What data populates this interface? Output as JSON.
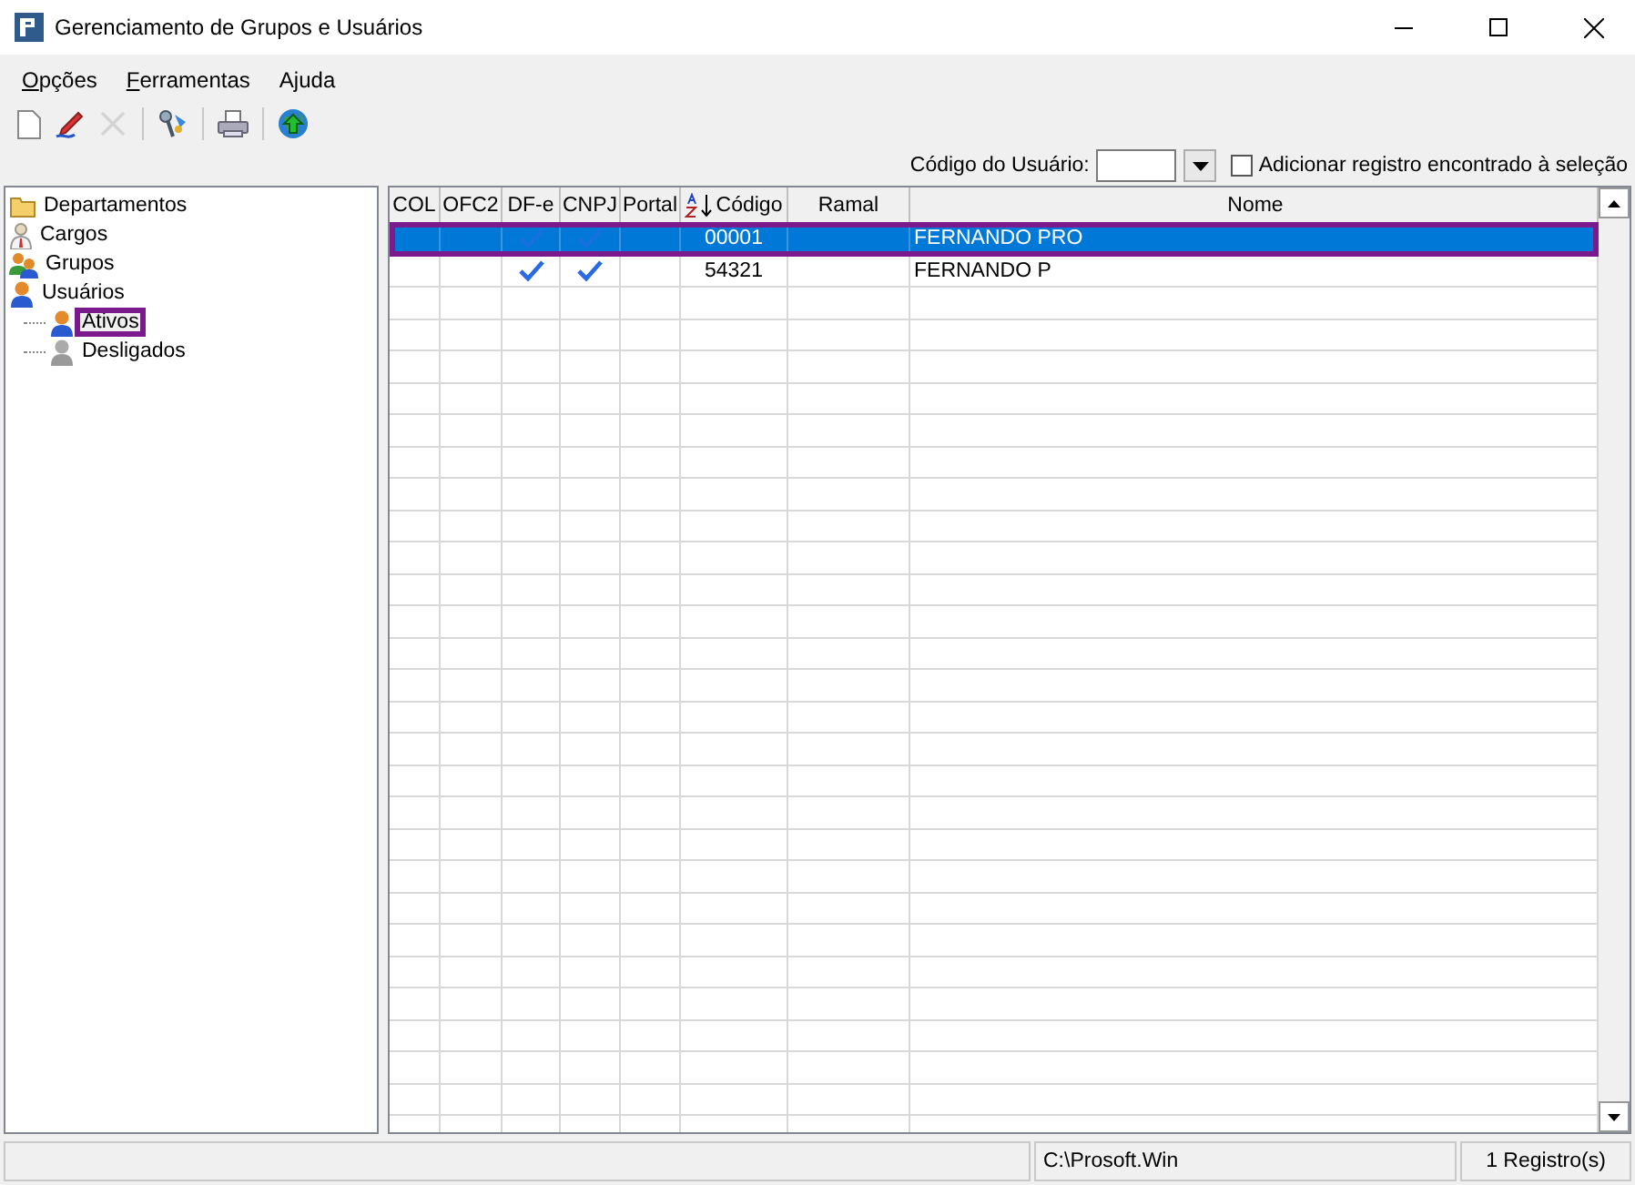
{
  "window": {
    "title": "Gerenciamento de Grupos e Usuários"
  },
  "menu": [
    {
      "label": "Opções",
      "underline_first": true
    },
    {
      "label": "Ferramentas",
      "underline_first": true
    },
    {
      "label": "Ajuda",
      "underline_first": false
    }
  ],
  "toolbar": [
    {
      "kind": "new",
      "disabled": false
    },
    {
      "kind": "edit",
      "disabled": false
    },
    {
      "kind": "delete",
      "disabled": true
    },
    {
      "kind": "sep"
    },
    {
      "kind": "keys",
      "disabled": false
    },
    {
      "kind": "sep"
    },
    {
      "kind": "print",
      "disabled": false
    },
    {
      "kind": "sep"
    },
    {
      "kind": "globe",
      "disabled": false
    }
  ],
  "filter": {
    "label": "Código do Usuário:",
    "add_checkbox": {
      "label": "Adicionar registro encontrado à seleção",
      "checked": false
    }
  },
  "tree": [
    {
      "label": "Departamentos",
      "kind": "folder",
      "selected": false,
      "highlighted": false
    },
    {
      "label": "Cargos",
      "kind": "person",
      "selected": false,
      "highlighted": false
    },
    {
      "label": "Grupos",
      "kind": "group",
      "selected": false,
      "highlighted": false
    },
    {
      "label": "Usuários",
      "kind": "user",
      "selected": false,
      "highlighted": false,
      "children": [
        {
          "label": "Ativos",
          "kind": "user",
          "selected": true,
          "highlighted": true
        },
        {
          "label": "Desligados",
          "kind": "inactive",
          "selected": false,
          "highlighted": false
        }
      ]
    }
  ],
  "table": {
    "columns": [
      {
        "label": "COL"
      },
      {
        "label": "OFC2"
      },
      {
        "label": "DF-e"
      },
      {
        "label": "CNPJ"
      },
      {
        "label": "Portal"
      },
      {
        "label": "Código",
        "sorted": true
      },
      {
        "label": "Ramal"
      },
      {
        "label": "Nome"
      }
    ],
    "rows": [
      {
        "selected": true,
        "highlighted": true,
        "col": false,
        "ofc2": false,
        "dfe": true,
        "cnpj": true,
        "portal": false,
        "codigo": "00001",
        "nome": "FERNANDO PRO"
      },
      {
        "selected": false,
        "highlighted": false,
        "col": false,
        "ofc2": false,
        "dfe": true,
        "cnpj": true,
        "portal": false,
        "codigo": "54321",
        "nome": "FERNANDO P"
      }
    ]
  },
  "status_bar": {
    "path": "C:\\Prosoft.Win",
    "count": "1 Registro(s)"
  }
}
